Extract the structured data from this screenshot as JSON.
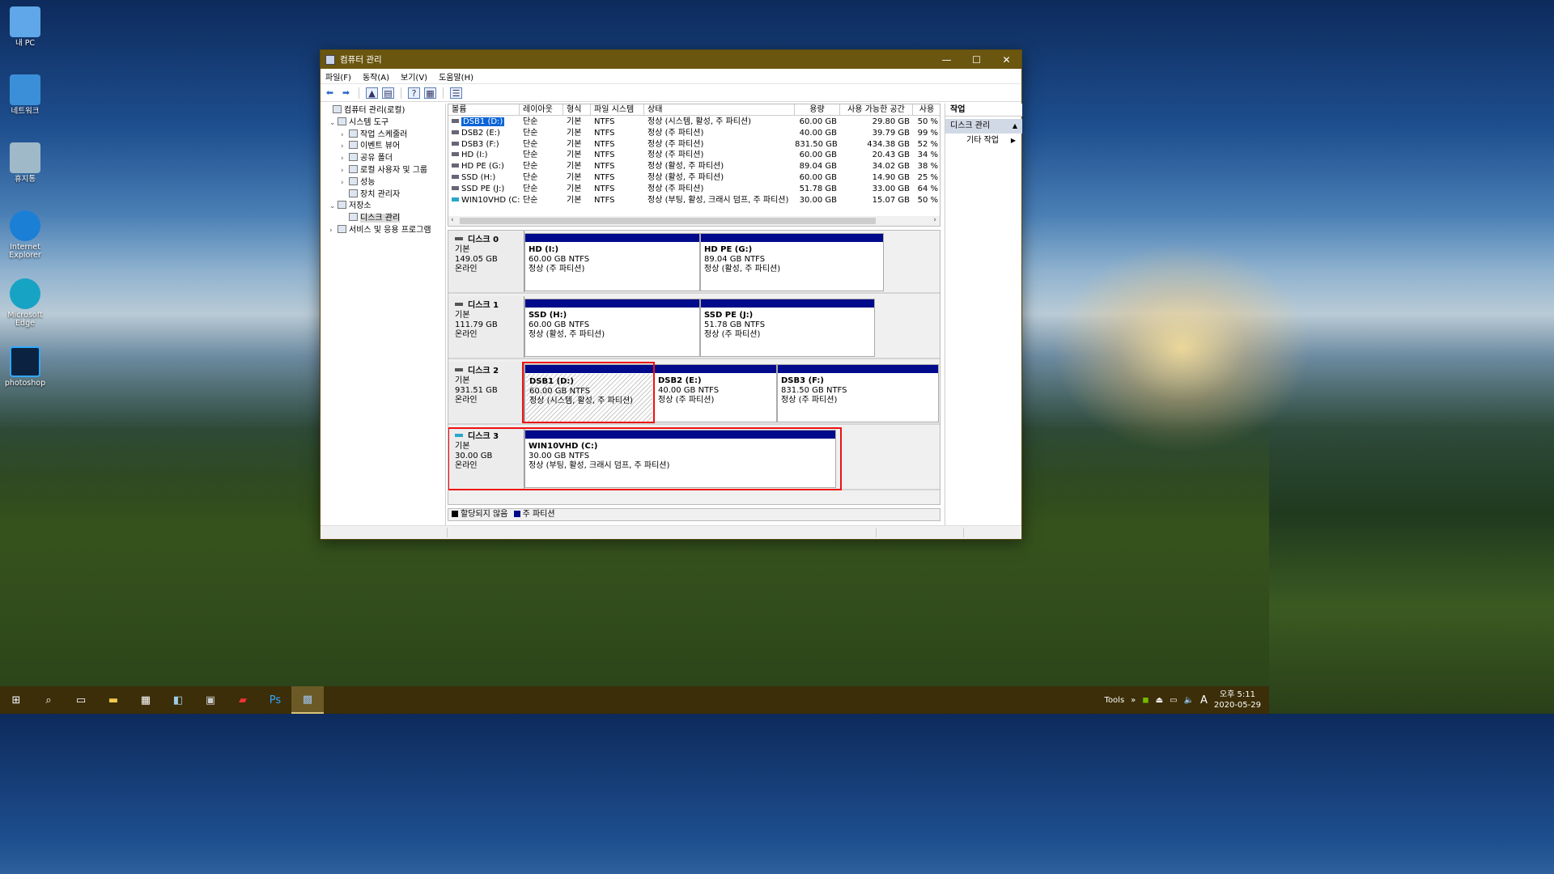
{
  "desktop": {
    "icons": [
      {
        "label": "내 PC",
        "icon": "this-pc-icon",
        "color": "#5fa7e8"
      },
      {
        "label": "네트워크",
        "icon": "network-icon",
        "color": "#3b8fd8"
      },
      {
        "label": "휴지통",
        "icon": "recycle-bin-icon",
        "color": "#9fb9c9"
      },
      {
        "label": "Internet Explorer",
        "icon": "internet-explorer-icon",
        "color": "#1b7fd6"
      },
      {
        "label": "Microsoft Edge",
        "icon": "edge-icon",
        "color": "#17a3c4"
      },
      {
        "label": "photoshop",
        "icon": "photoshop-icon",
        "color": "#0b2340"
      }
    ]
  },
  "window": {
    "title": "컴퓨터 관리",
    "menu": [
      "파일(F)",
      "동작(A)",
      "보기(V)",
      "도움말(H)"
    ],
    "tree": [
      {
        "label": "컴퓨터 관리(로컬)",
        "level": 0,
        "expander": ""
      },
      {
        "label": "시스템 도구",
        "level": 1,
        "expander": "⌄"
      },
      {
        "label": "작업 스케줄러",
        "level": 2,
        "expander": "›"
      },
      {
        "label": "이벤트 뷰어",
        "level": 2,
        "expander": "›"
      },
      {
        "label": "공유 폴더",
        "level": 2,
        "expander": "›"
      },
      {
        "label": "로컬 사용자 및 그룹",
        "level": 2,
        "expander": "›"
      },
      {
        "label": "성능",
        "level": 2,
        "expander": "›"
      },
      {
        "label": "장치 관리자",
        "level": 2,
        "expander": ""
      },
      {
        "label": "저장소",
        "level": 1,
        "expander": "⌄"
      },
      {
        "label": "디스크 관리",
        "level": 2,
        "expander": "",
        "selected": true
      },
      {
        "label": "서비스 및 응용 프로그램",
        "level": 1,
        "expander": "›"
      }
    ],
    "volume_columns": [
      "볼륨",
      "레이아웃",
      "형식",
      "파일 시스템",
      "상태",
      "용량",
      "사용 가능한 공간",
      "사용"
    ],
    "volumes": [
      [
        "DSB1 (D:)",
        "단순",
        "기본",
        "NTFS",
        "정상 (시스템, 활성, 주 파티션)",
        "60.00 GB",
        "29.80 GB",
        "50 %"
      ],
      [
        "DSB2 (E:)",
        "단순",
        "기본",
        "NTFS",
        "정상 (주 파티션)",
        "40.00 GB",
        "39.79 GB",
        "99 %"
      ],
      [
        "DSB3 (F:)",
        "단순",
        "기본",
        "NTFS",
        "정상 (주 파티션)",
        "831.50 GB",
        "434.38 GB",
        "52 %"
      ],
      [
        "HD (I:)",
        "단순",
        "기본",
        "NTFS",
        "정상 (주 파티션)",
        "60.00 GB",
        "20.43 GB",
        "34 %"
      ],
      [
        "HD PE (G:)",
        "단순",
        "기본",
        "NTFS",
        "정상 (활성, 주 파티션)",
        "89.04 GB",
        "34.02 GB",
        "38 %"
      ],
      [
        "SSD (H:)",
        "단순",
        "기본",
        "NTFS",
        "정상 (활성, 주 파티션)",
        "60.00 GB",
        "14.90 GB",
        "25 %"
      ],
      [
        "SSD PE (J:)",
        "단순",
        "기본",
        "NTFS",
        "정상 (주 파티션)",
        "51.78 GB",
        "33.00 GB",
        "64 %"
      ],
      [
        "WIN10VHD (C:)",
        "단순",
        "기본",
        "NTFS",
        "정상 (부팅, 활성, 크래시 덤프, 주 파티션)",
        "30.00 GB",
        "15.07 GB",
        "50 %"
      ]
    ],
    "disks": [
      {
        "name": "디스크 0",
        "type": "기본",
        "size": "149.05 GB",
        "state": "온라인",
        "partitions": [
          {
            "name": "HD  (I:)",
            "size": "60.00 GB NTFS",
            "status": "정상 (주 파티션)"
          },
          {
            "name": "HD PE  (G:)",
            "size": "89.04 GB NTFS",
            "status": "정상 (활성, 주 파티션)"
          }
        ]
      },
      {
        "name": "디스크 1",
        "type": "기본",
        "size": "111.79 GB",
        "state": "온라인",
        "partitions": [
          {
            "name": "SSD  (H:)",
            "size": "60.00 GB NTFS",
            "status": "정상 (활성, 주 파티션)"
          },
          {
            "name": "SSD PE  (J:)",
            "size": "51.78 GB NTFS",
            "status": "정상 (주 파티션)"
          }
        ]
      },
      {
        "name": "디스크 2",
        "type": "기본",
        "size": "931.51 GB",
        "state": "온라인",
        "partitions": [
          {
            "name": "DSB1  (D:)",
            "size": "60.00 GB NTFS",
            "status": "정상 (시스템, 활성, 주 파티션)"
          },
          {
            "name": "DSB2  (E:)",
            "size": "40.00 GB NTFS",
            "status": "정상 (주 파티션)"
          },
          {
            "name": "DSB3  (F:)",
            "size": "831.50 GB NTFS",
            "status": "정상 (주 파티션)"
          }
        ]
      },
      {
        "name": "디스크 3",
        "type": "기본",
        "size": "30.00 GB",
        "state": "온라인",
        "partitions": [
          {
            "name": "WIN10VHD  (C:)",
            "size": "30.00 GB NTFS",
            "status": "정상 (부팅, 활성, 크래시 덤프, 주 파티션)"
          }
        ]
      }
    ],
    "legend": {
      "unallocated": "할당되지 않음",
      "primary": "주 파티션",
      "unallocated_color": "#000000",
      "primary_color": "#000a8a"
    },
    "actions": {
      "header": "작업",
      "selected": "디스크 관리",
      "more": "기타 작업"
    }
  },
  "taskbar": {
    "tools_label": "Tools",
    "ime": "A",
    "time": "오후 5:11",
    "date": "2020-05-29"
  }
}
